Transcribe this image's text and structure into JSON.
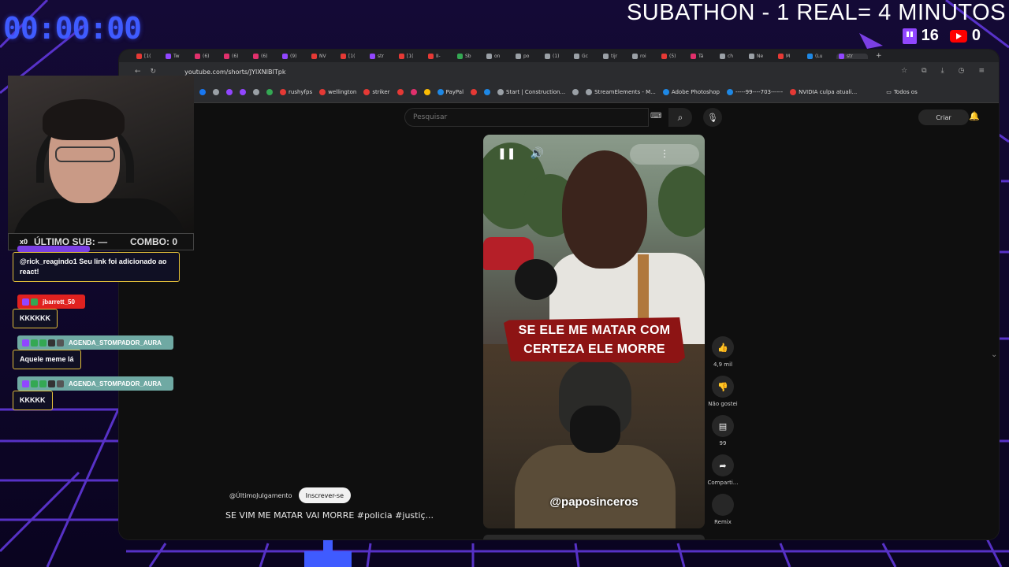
{
  "overlay": {
    "timer": "00:00:00",
    "subathon_text": "SUBATHON - 1 REAL= 4 MINUTOS",
    "twitch_count": "16",
    "youtube_count": "0",
    "last_sub_label": "ÚLTIMO SUB: —",
    "combo_label": "COMBO: 0",
    "multiplier": "x0"
  },
  "browser": {
    "tabs": [
      {
        "label": "[1(",
        "color": "#e53935"
      },
      {
        "label": "Tw",
        "color": "#9146ff"
      },
      {
        "label": "(6)",
        "color": "#e1306c"
      },
      {
        "label": "(6)",
        "color": "#e1306c"
      },
      {
        "label": "(6)",
        "color": "#e1306c"
      },
      {
        "label": "(9)",
        "color": "#9146ff"
      },
      {
        "label": "NV",
        "color": "#e53935"
      },
      {
        "label": "[1(",
        "color": "#e53935"
      },
      {
        "label": "str",
        "color": "#9146ff"
      },
      {
        "label": "[1(",
        "color": "#e53935"
      },
      {
        "label": "II-",
        "color": "#e53935"
      },
      {
        "label": "Sb",
        "color": "#34a853"
      },
      {
        "label": "on",
        "color": "#9aa0a6"
      },
      {
        "label": "po",
        "color": "#9aa0a6"
      },
      {
        "label": "(1)",
        "color": "#9aa0a6"
      },
      {
        "label": "Gc",
        "color": "#9aa0a6"
      },
      {
        "label": "tijr",
        "color": "#9aa0a6"
      },
      {
        "label": "roi",
        "color": "#9aa0a6"
      },
      {
        "label": "(5)",
        "color": "#e53935"
      },
      {
        "label": "Tá",
        "color": "#e1306c"
      },
      {
        "label": "ch",
        "color": "#9aa0a6"
      },
      {
        "label": "Ne",
        "color": "#9aa0a6"
      },
      {
        "label": "M",
        "color": "#e53935"
      },
      {
        "label": "(Lu",
        "color": "#1e88e5"
      }
    ],
    "active_tab_label": "str",
    "url": "youtube.com/shorts/JYlXNIBITpk",
    "bookmarks": [
      {
        "label": "",
        "color": "#1877f2"
      },
      {
        "label": "",
        "color": "#9aa0a6"
      },
      {
        "label": "",
        "color": "#9146ff"
      },
      {
        "label": "",
        "color": "#9146ff"
      },
      {
        "label": "",
        "color": "#9aa0a6"
      },
      {
        "label": "",
        "color": "#34a853"
      },
      {
        "label": "rushyfps",
        "color": "#e53935"
      },
      {
        "label": "wellington",
        "color": "#e53935"
      },
      {
        "label": "striker",
        "color": "#e53935"
      },
      {
        "label": "",
        "color": "#e53935"
      },
      {
        "label": "",
        "color": "#e1306c"
      },
      {
        "label": "",
        "color": "#fbbc04"
      },
      {
        "label": "PayPal",
        "color": "#1e88e5"
      },
      {
        "label": "",
        "color": "#e53935"
      },
      {
        "label": "",
        "color": "#1e88e5"
      },
      {
        "label": "Start | Construction...",
        "color": "#9aa0a6"
      },
      {
        "label": "",
        "color": "#9aa0a6"
      },
      {
        "label": "StreamElements - M...",
        "color": "#9aa0a6"
      },
      {
        "label": "Adobe Photoshop",
        "color": "#1e88e5"
      },
      {
        "label": "-----99----703------",
        "color": "#1e88e5"
      },
      {
        "label": "NVIDIA culpa atuali...",
        "color": "#e53935"
      }
    ],
    "all_bookmarks_label": "Todos os"
  },
  "youtube": {
    "search_placeholder": "Pesquisar",
    "create_label": "Criar",
    "caption_line1": "SE ELE ME MATAR COM",
    "caption_line2": "CERTEZA ELE MORRE",
    "watermark": "@paposinceros",
    "like_count": "4,9 mil",
    "dislike_label": "Não gostei",
    "comment_count": "99",
    "share_label": "Comparti...",
    "remix_label": "Remix",
    "channel_name": "@ÚltimoJulgamento",
    "subscribe_label": "Inscrever-se",
    "video_title": "SE VIM ME MATAR VAI MORRE #policia #justiç..."
  },
  "chat": [
    {
      "user": "",
      "message": "@rick_reagindo1 Seu link foi adicionado ao react!",
      "header_color": "#7b3fe4"
    },
    {
      "user": "jbarrett_50",
      "message": "KKKKKK",
      "header_color": "#e0211f"
    },
    {
      "user": "AGENDA_STOMPADOR_AURA",
      "message": "Aquele meme lá",
      "header_color": "#6fa9a3"
    },
    {
      "user": "AGENDA_STOMPADOR_AURA",
      "message": "KKKKK",
      "header_color": "#6fa9a3"
    }
  ]
}
